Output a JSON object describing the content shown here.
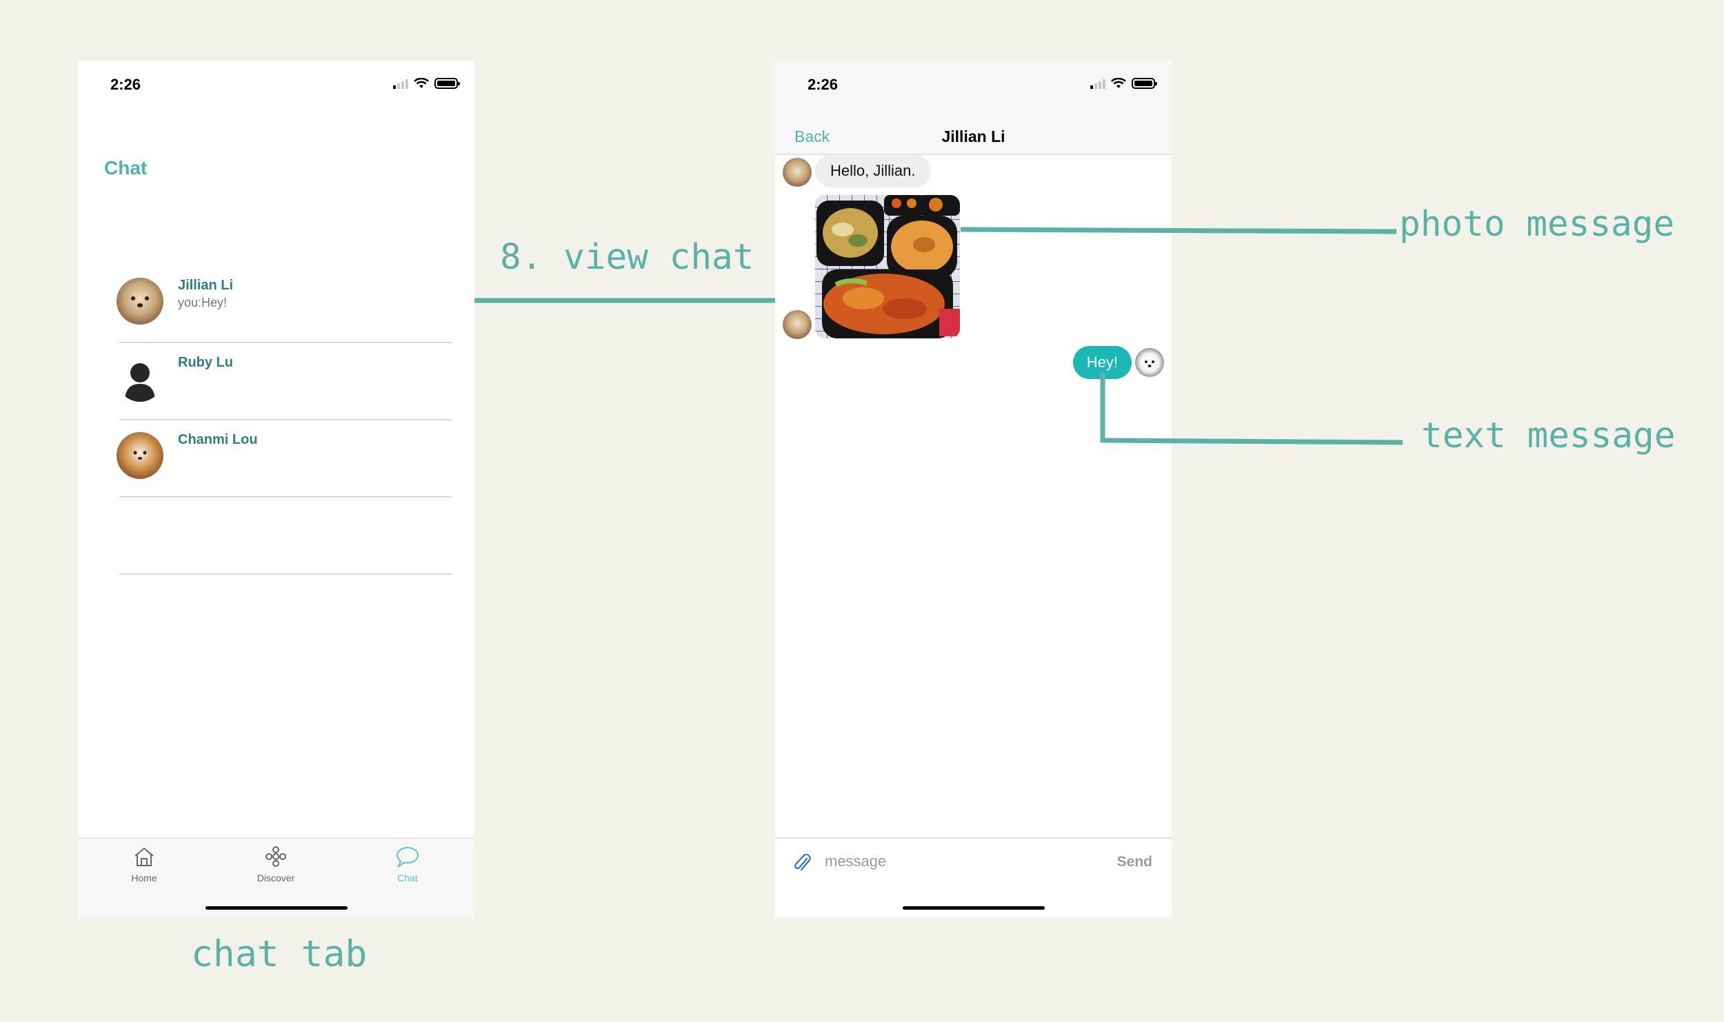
{
  "colors": {
    "background": "#f3f2ea",
    "accent": "#4fb3aa",
    "annotation": "#5ab1a6",
    "outgoing_bubble": "#1bb7b4"
  },
  "left_screen": {
    "status_time": "2:26",
    "title": "Chat",
    "chats": [
      {
        "name": "Jillian Li",
        "preview": "you:Hey!",
        "avatar": "dog-photo"
      },
      {
        "name": "Ruby Lu",
        "preview": "",
        "avatar": "person-silhouette-icon"
      },
      {
        "name": "Chanmi Lou",
        "preview": "",
        "avatar": "shiba-photo"
      },
      {
        "name": "",
        "preview": "",
        "avatar": ""
      }
    ],
    "tabs": [
      {
        "label": "Home",
        "icon": "home-icon",
        "active": false
      },
      {
        "label": "Discover",
        "icon": "discover-icon",
        "active": false
      },
      {
        "label": "Chat",
        "icon": "chat-bubble-icon",
        "active": true
      }
    ]
  },
  "right_screen": {
    "status_time": "2:26",
    "back_label": "Back",
    "title": "Jillian Li",
    "messages": [
      {
        "direction": "incoming",
        "type": "text",
        "text": "Hello, Jillian."
      },
      {
        "direction": "incoming",
        "type": "photo",
        "description": "food photo"
      },
      {
        "direction": "outgoing",
        "type": "text",
        "text": "Hey!"
      }
    ],
    "input_placeholder": "message",
    "send_label": "Send",
    "attach_icon": "paperclip-icon"
  },
  "annotations": {
    "view_chat": "8. view chat",
    "photo_message": "photo message",
    "text_message": "text message",
    "chat_tab": "chat tab"
  }
}
